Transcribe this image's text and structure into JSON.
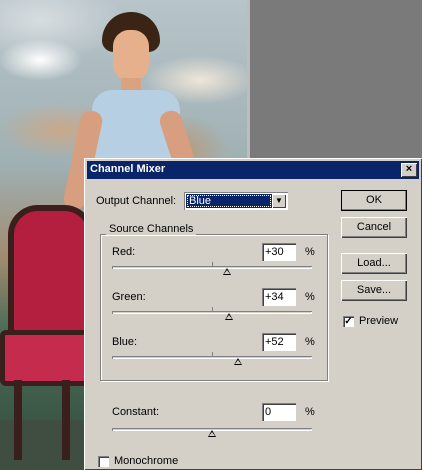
{
  "dialog": {
    "title": "Channel Mixer",
    "close_glyph": "×",
    "output_channel_label": "Output Channel:",
    "output_channel_value": "Blue",
    "source_channels_label": "Source Channels",
    "channels": [
      {
        "label": "Red:",
        "value": "+30",
        "unit": "%",
        "level": 30
      },
      {
        "label": "Green:",
        "value": "+34",
        "unit": "%",
        "level": 34
      },
      {
        "label": "Blue:",
        "value": "+52",
        "unit": "%",
        "level": 52
      }
    ],
    "constant": {
      "label": "Constant:",
      "value": "0",
      "unit": "%",
      "level": 0
    },
    "monochrome_label": "Monochrome",
    "monochrome_checked": false,
    "preview_label": "Preview",
    "preview_checked": true,
    "buttons": {
      "ok": "OK",
      "cancel": "Cancel",
      "load": "Load...",
      "save": "Save..."
    }
  },
  "icons": {
    "dropdown": "chevron-down-icon",
    "check": "checkmark-icon"
  },
  "colors": {
    "titlebar": "#0a246a",
    "dialog_bg": "#d4d0c8",
    "selection": "#0a246a"
  }
}
